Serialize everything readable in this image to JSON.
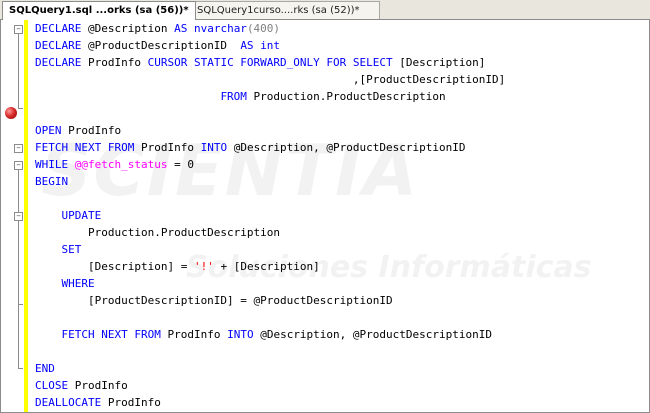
{
  "tabs": [
    {
      "label": "SQLQuery1.sql ...orks (sa (56))*",
      "active": true
    },
    {
      "label": "SQLQuery1curso....rks (sa (52))*",
      "active": false
    }
  ],
  "watermark": {
    "brand": "SCIENTIA",
    "tagline": "Soluciones Informáticas"
  },
  "editor": {
    "breakpoint_line": 7,
    "lines": [
      [
        {
          "t": "DECLARE",
          "c": "k"
        },
        {
          "t": " @Description ",
          "c": ""
        },
        {
          "t": "AS",
          "c": "k"
        },
        {
          "t": " ",
          "c": ""
        },
        {
          "t": "nvarchar",
          "c": "k"
        },
        {
          "t": "(400)",
          "c": "g"
        }
      ],
      [
        {
          "t": "DECLARE",
          "c": "k"
        },
        {
          "t": " @ProductDescriptionID  ",
          "c": ""
        },
        {
          "t": "AS",
          "c": "k"
        },
        {
          "t": " ",
          "c": ""
        },
        {
          "t": "int",
          "c": "k"
        }
      ],
      [
        {
          "t": "DECLARE",
          "c": "k"
        },
        {
          "t": " ProdInfo ",
          "c": ""
        },
        {
          "t": "CURSOR STATIC FORWARD_ONLY FOR SELECT",
          "c": "k"
        },
        {
          "t": " [Description]",
          "c": ""
        }
      ],
      [
        {
          "t": "                                                ,[ProductDescriptionID]",
          "c": ""
        }
      ],
      [
        {
          "t": "                            ",
          "c": ""
        },
        {
          "t": "FROM",
          "c": "k"
        },
        {
          "t": " Production.ProductDescription",
          "c": ""
        }
      ],
      [],
      [
        {
          "t": "OPEN",
          "c": "k"
        },
        {
          "t": " ProdInfo",
          "c": ""
        }
      ],
      [
        {
          "t": "FETCH NEXT FROM",
          "c": "k"
        },
        {
          "t": " ProdInfo ",
          "c": ""
        },
        {
          "t": "INTO",
          "c": "k"
        },
        {
          "t": " @Description, @ProductDescriptionID",
          "c": ""
        }
      ],
      [
        {
          "t": "WHILE",
          "c": "k"
        },
        {
          "t": " ",
          "c": ""
        },
        {
          "t": "@@fetch_status",
          "c": "m"
        },
        {
          "t": " = 0",
          "c": ""
        }
      ],
      [
        {
          "t": "BEGIN",
          "c": "k"
        }
      ],
      [],
      [
        {
          "t": "    ",
          "c": ""
        },
        {
          "t": "UPDATE",
          "c": "k"
        }
      ],
      [
        {
          "t": "        Production.ProductDescription",
          "c": ""
        }
      ],
      [
        {
          "t": "    ",
          "c": ""
        },
        {
          "t": "SET",
          "c": "k"
        }
      ],
      [
        {
          "t": "        [Description] = ",
          "c": ""
        },
        {
          "t": "'!'",
          "c": "s"
        },
        {
          "t": " + [Description]",
          "c": ""
        }
      ],
      [
        {
          "t": "    ",
          "c": ""
        },
        {
          "t": "WHERE",
          "c": "k"
        }
      ],
      [
        {
          "t": "        [ProductDescriptionID] = @ProductDescriptionID",
          "c": ""
        }
      ],
      [],
      [
        {
          "t": "    ",
          "c": ""
        },
        {
          "t": "FETCH NEXT FROM",
          "c": "k"
        },
        {
          "t": " ProdInfo ",
          "c": ""
        },
        {
          "t": "INTO",
          "c": "k"
        },
        {
          "t": " @Description, @ProductDescriptionID",
          "c": ""
        }
      ],
      [],
      [
        {
          "t": "END",
          "c": "k"
        }
      ],
      [
        {
          "t": "CLOSE",
          "c": "k"
        },
        {
          "t": " ProdInfo",
          "c": ""
        }
      ],
      [
        {
          "t": "DEALLOCATE",
          "c": "k"
        },
        {
          "t": " ProdInfo",
          "c": ""
        }
      ]
    ]
  }
}
